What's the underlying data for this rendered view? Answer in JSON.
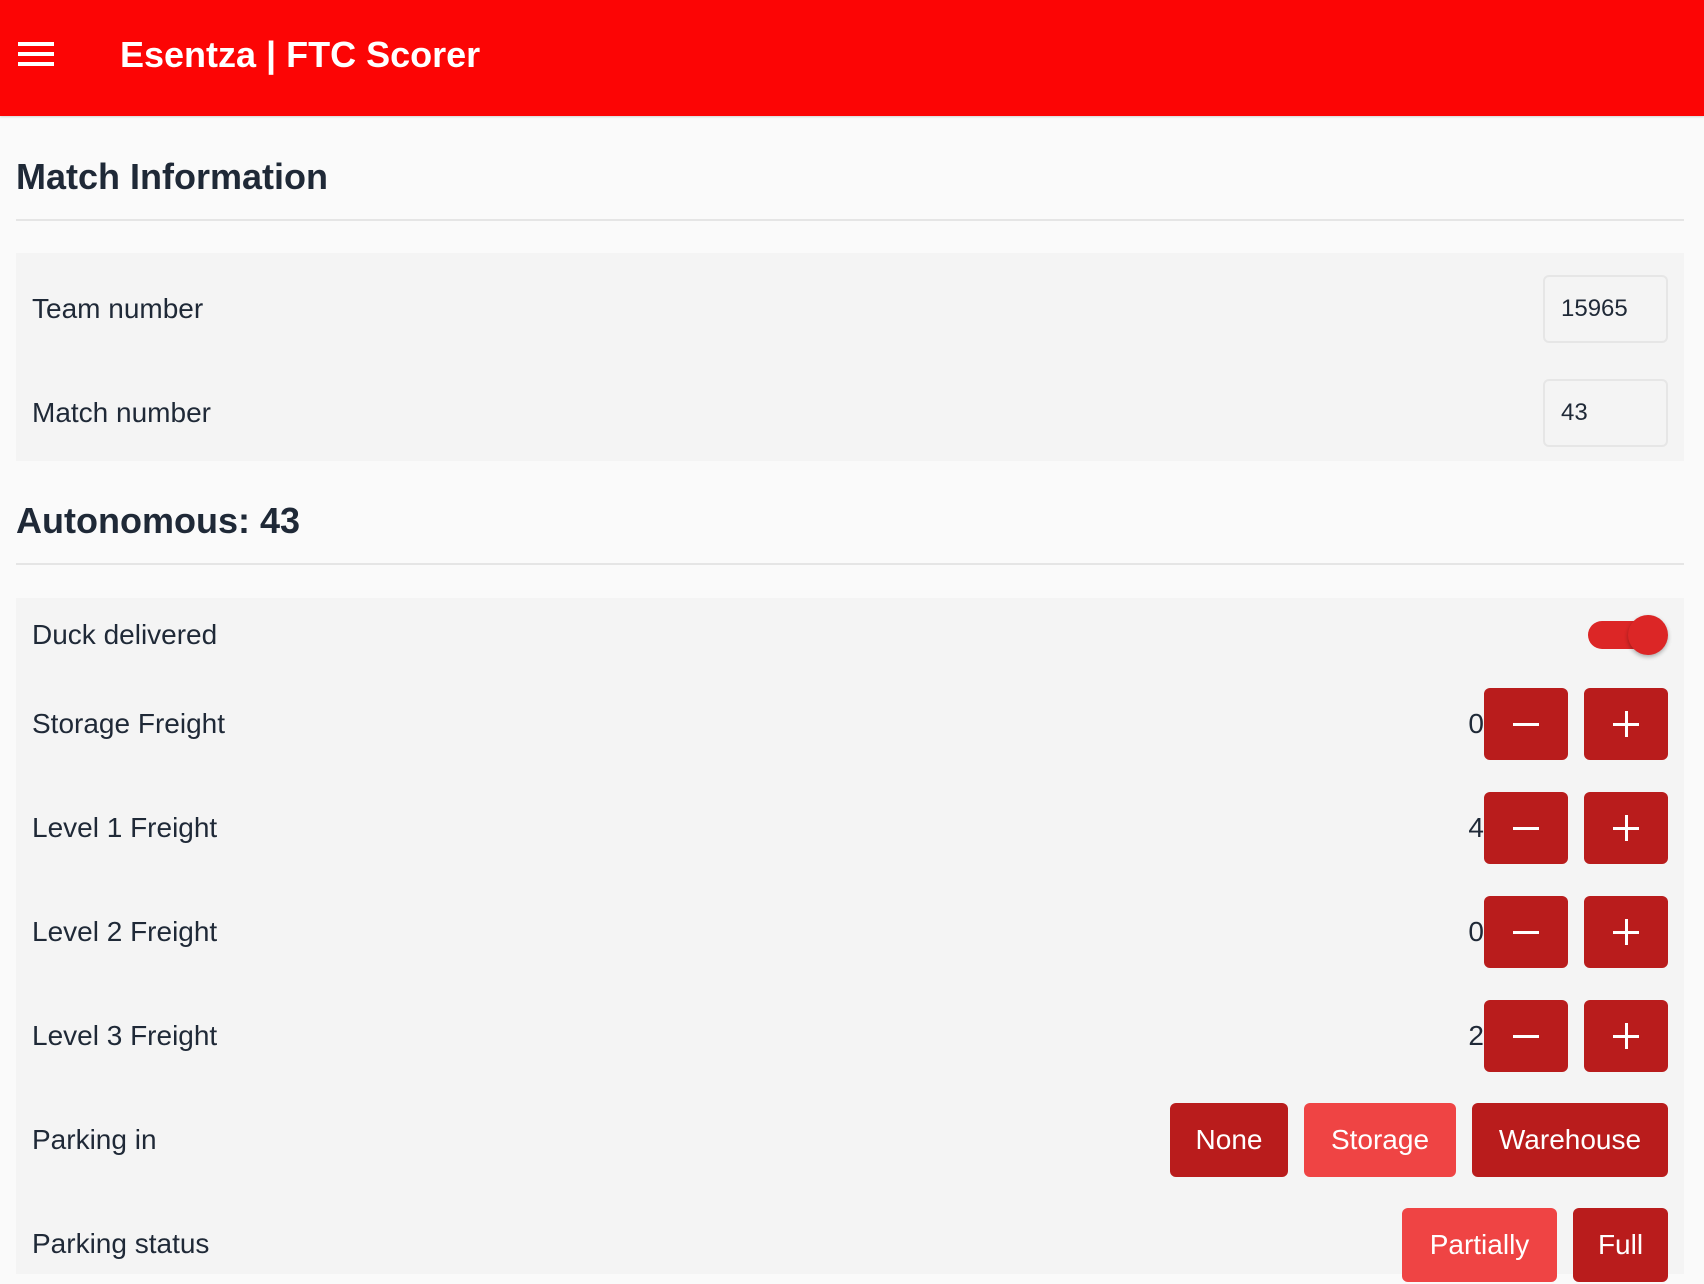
{
  "header": {
    "menu_icon": "hamburger-menu-icon",
    "title": "Esentza | FTC Scorer",
    "background_color": "#fc0505"
  },
  "match_info": {
    "title": "Match Information",
    "team_number": {
      "label": "Team number",
      "value": "15965"
    },
    "match_number": {
      "label": "Match number",
      "value": "43"
    }
  },
  "autonomous": {
    "title": "Autonomous: 43",
    "duck_delivered": {
      "label": "Duck delivered",
      "checked": true
    },
    "counters": [
      {
        "label": "Storage Freight",
        "value": "0",
        "minus": "minus-icon",
        "plus": "plus-icon"
      },
      {
        "label": "Level 1 Freight",
        "value": "4",
        "minus": "minus-icon",
        "plus": "plus-icon"
      },
      {
        "label": "Level 2 Freight",
        "value": "0",
        "minus": "minus-icon",
        "plus": "plus-icon"
      },
      {
        "label": "Level 3 Freight",
        "value": "2",
        "minus": "minus-icon",
        "plus": "plus-icon"
      }
    ],
    "parking_in": {
      "label": "Parking in",
      "options": [
        "None",
        "Storage",
        "Warehouse"
      ],
      "selected": "Storage"
    },
    "parking_status": {
      "label": "Parking status",
      "options": [
        "Partially",
        "Full"
      ],
      "selected": "Partially"
    }
  },
  "colors": {
    "button": "#b91c1c",
    "button_selected": "#ef4444",
    "toggle_on": "#dc2626"
  }
}
